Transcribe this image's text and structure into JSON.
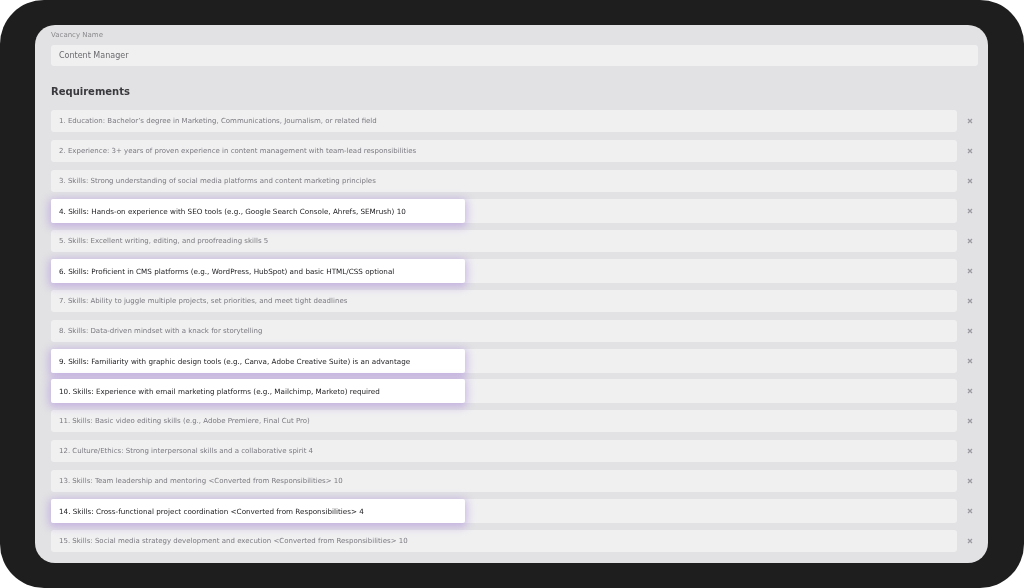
{
  "vacancy": {
    "label": "Vacancy Name",
    "value": "Content Manager"
  },
  "requirements": {
    "title": "Requirements",
    "items": [
      {
        "text": "1. Education: Bachelor’s degree in Marketing, Communications, Journalism, or related field",
        "highlighted": false
      },
      {
        "text": "2. Experience: 3+ years of proven experience in content management with team-lead responsibilities",
        "highlighted": false
      },
      {
        "text": "3. Skills: Strong understanding of social media platforms and content marketing principles",
        "highlighted": false
      },
      {
        "text": "4. Skills: Hands-on experience with SEO tools (e.g., Google Search Console, Ahrefs, SEMrush) 10",
        "highlighted": true
      },
      {
        "text": "5. Skills: Excellent writing, editing, and proofreading skills 5",
        "highlighted": false
      },
      {
        "text": "6. Skills: Proficient in CMS platforms (e.g., WordPress, HubSpot) and basic HTML/CSS optional",
        "highlighted": true
      },
      {
        "text": "7. Skills: Ability to juggle multiple projects, set priorities, and meet tight deadlines",
        "highlighted": false
      },
      {
        "text": "8. Skills: Data-driven mindset with a knack for storytelling",
        "highlighted": false
      },
      {
        "text": "9. Skills: Familiarity with graphic design tools (e.g., Canva, Adobe Creative Suite) is an advantage",
        "highlighted": true
      },
      {
        "text": "10. Skills: Experience with email marketing platforms (e.g., Mailchimp, Marketo) required",
        "highlighted": true
      },
      {
        "text": "11. Skills: Basic video editing skills (e.g., Adobe Premiere, Final Cut Pro)",
        "highlighted": false
      },
      {
        "text": "12. Culture/Ethics: Strong interpersonal skills and a collaborative spirit 4",
        "highlighted": false
      },
      {
        "text": "13. Skills: Team leadership and mentoring <Converted from Responsibilities> 10",
        "highlighted": false
      },
      {
        "text": "14. Skills: Cross-functional project coordination <Converted from Responsibilities> 4",
        "highlighted": true
      },
      {
        "text": "15. Skills: Social media strategy development and execution <Converted from Responsibilities> 10",
        "highlighted": false
      }
    ]
  }
}
